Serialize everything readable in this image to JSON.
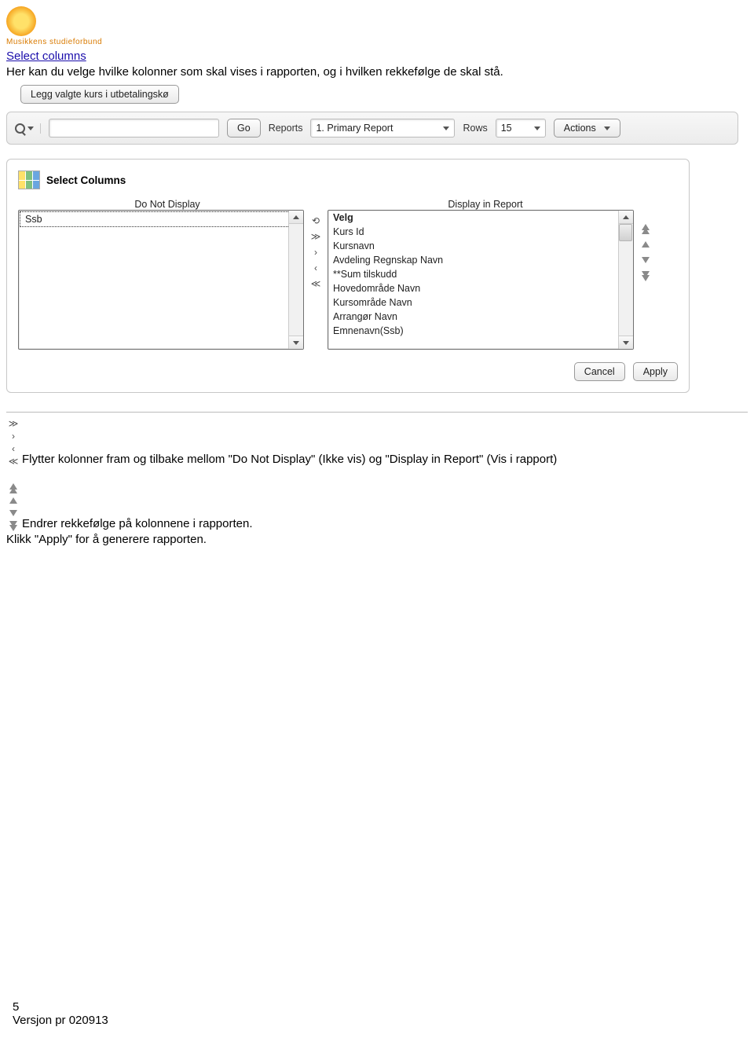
{
  "brand": {
    "name": "Musikkens studieforbund"
  },
  "section": {
    "title": "Select columns",
    "intro": "Her kan du velge hvilke kolonner som skal vises i rapporten, og i hvilken rekkefølge de skal stå."
  },
  "queue_button": "Legg valgte kurs i utbetalingskø",
  "toolbar": {
    "go_label": "Go",
    "reports_label": "Reports",
    "reports_value": "1. Primary Report",
    "rows_label": "Rows",
    "rows_value": "15",
    "actions_label": "Actions"
  },
  "panel": {
    "title": "Select Columns",
    "left_header": "Do Not Display",
    "right_header": "Display in Report",
    "left_items": [
      "Ssb"
    ],
    "right_items": [
      "Velg",
      "Kurs Id",
      "Kursnavn",
      "Avdeling Regnskap Navn",
      "**Sum tilskudd",
      "Hovedområde Navn",
      "Kursområde Navn",
      "Arrangør Navn",
      "Emnenavn(Ssb)"
    ],
    "cancel_label": "Cancel",
    "apply_label": "Apply"
  },
  "explain": {
    "move_text": "Flytter kolonner fram og tilbake mellom \"Do Not Display\" (Ikke vis) og \"Display in Report\" (Vis i rapport)",
    "order_text": "Endrer rekkefølge på kolonnene i rapporten.",
    "apply_text": "Klikk \"Apply\" for å generere rapporten."
  },
  "footer": {
    "page": "5",
    "version": "Versjon pr 020913"
  }
}
